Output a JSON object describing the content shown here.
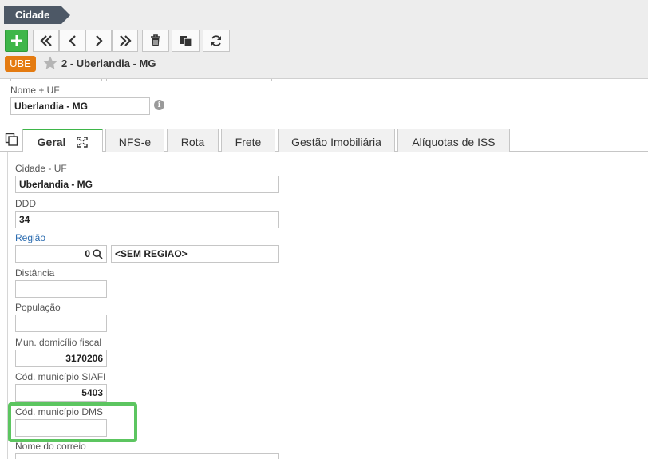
{
  "breadcrumb": {
    "label": "Cidade"
  },
  "record": {
    "badge": "UBE",
    "title": "2 - Uberlandia - MG"
  },
  "form": {
    "nome_uf": {
      "label": "Nome + UF",
      "value": "Uberlandia - MG"
    }
  },
  "tabs": [
    {
      "label": "Geral",
      "active": true
    },
    {
      "label": "NFS-e"
    },
    {
      "label": "Rota"
    },
    {
      "label": "Frete"
    },
    {
      "label": "Gestão Imobiliária"
    },
    {
      "label": "Alíquotas de ISS"
    }
  ],
  "geral": {
    "cidade_uf": {
      "label": "Cidade - UF",
      "value": "Uberlandia - MG"
    },
    "ddd": {
      "label": "DDD",
      "value": "34"
    },
    "regiao": {
      "label": "Região",
      "code": "0",
      "name": "<SEM REGIAO>"
    },
    "distancia": {
      "label": "Distância",
      "value": ""
    },
    "populacao": {
      "label": "População",
      "value": ""
    },
    "mun_domicilio": {
      "label": "Mun. domicílio fiscal",
      "value": "3170206"
    },
    "cod_siafi": {
      "label": "Cód. município SIAFI",
      "value": "5403"
    },
    "cod_dms": {
      "label": "Cód. município DMS",
      "value": ""
    },
    "nome_correio": {
      "label": "Nome do correio",
      "value": ""
    }
  },
  "colors": {
    "accent_green": "#3eb649",
    "badge_orange": "#e47b11",
    "breadcrumb_bg": "#4d5866",
    "link_blue": "#2b6cb0"
  }
}
